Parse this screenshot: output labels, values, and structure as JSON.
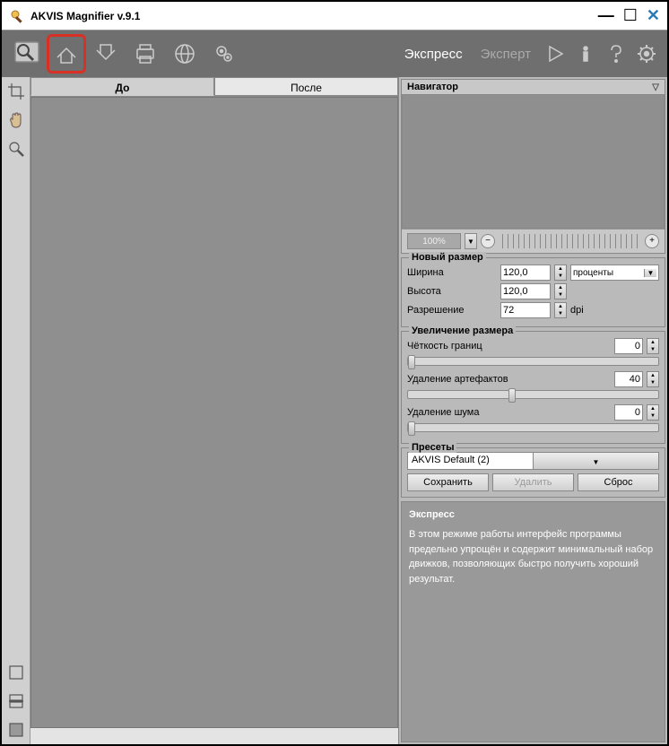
{
  "title": "AKVIS Magnifier v.9.1",
  "modes": {
    "express": "Экспресс",
    "expert": "Эксперт"
  },
  "tabs": {
    "before": "До",
    "after": "После"
  },
  "navigator": {
    "title": "Навигатор",
    "zoom": "100%"
  },
  "newsize": {
    "title": "Новый размер",
    "width_label": "Ширина",
    "width_value": "120,0",
    "height_label": "Высота",
    "height_value": "120,0",
    "res_label": "Разрешение",
    "res_value": "72",
    "units": "проценты",
    "dpi": "dpi"
  },
  "upscale": {
    "title": "Увеличение размера",
    "edge_label": "Чёткость границ",
    "edge_value": "0",
    "artifact_label": "Удаление артефактов",
    "artifact_value": "40",
    "noise_label": "Удаление шума",
    "noise_value": "0"
  },
  "presets": {
    "title": "Пресеты",
    "current": "AKVIS Default (2)",
    "save": "Сохранить",
    "delete": "Удалить",
    "reset": "Сброс"
  },
  "info": {
    "title": "Экспресс",
    "text": "В этом режиме работы интерфейс программы предельно упрощён и содержит минимальный набор движков, позволяющих быстро получить хороший результат."
  }
}
